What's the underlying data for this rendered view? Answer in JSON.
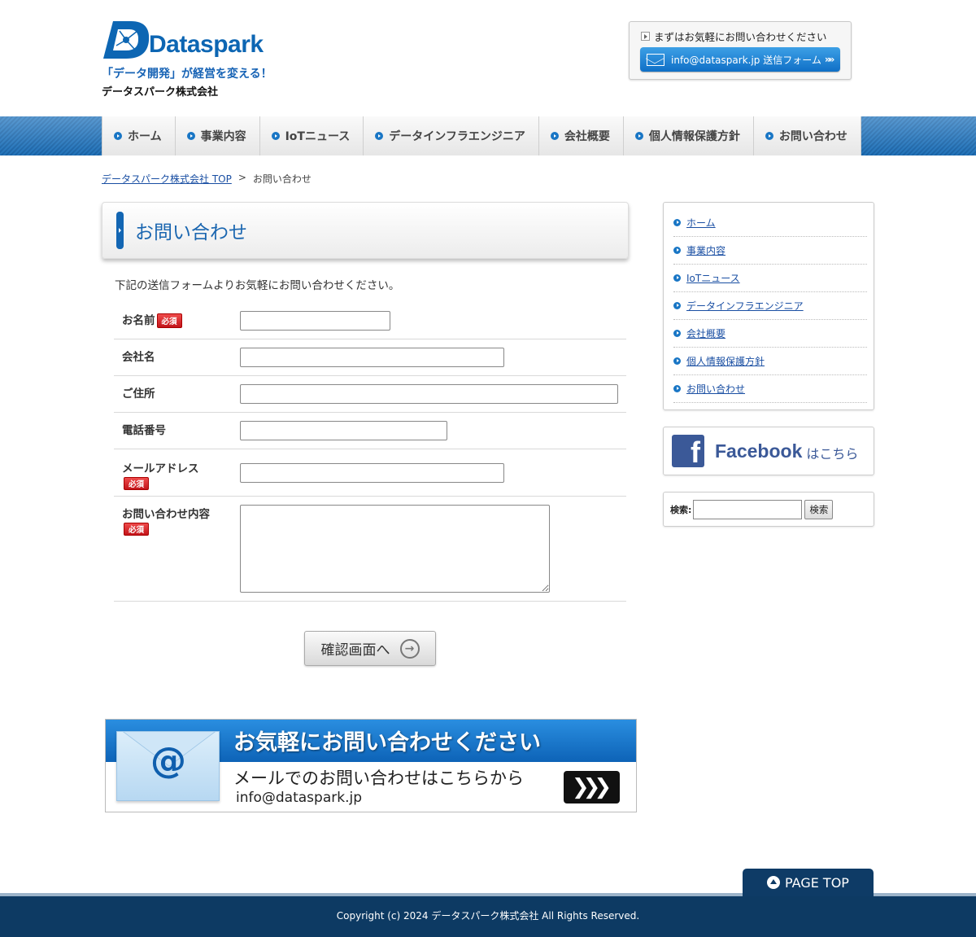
{
  "header": {
    "logo_text": "Dataspark",
    "tagline": "「データ開発」が経営を変える！",
    "company": "データスパーク株式会社",
    "contact_note": "まずはお気軽にお問い合わせください",
    "contact_button": "info@dataspark.jp 送信フォーム"
  },
  "nav": [
    {
      "label": "ホーム"
    },
    {
      "label": "事業内容"
    },
    {
      "label": "IoTニュース"
    },
    {
      "label": "データインフラエンジニア"
    },
    {
      "label": "会社概要"
    },
    {
      "label": "個人情報保護方針"
    },
    {
      "label": "お問い合わせ"
    }
  ],
  "breadcrumb": {
    "home": "データスパーク株式会社 TOP",
    "separator": ">",
    "current": "お問い合わせ"
  },
  "page": {
    "title": "お問い合わせ",
    "intro": "下記の送信フォームよりお気軽にお問い合わせください。"
  },
  "form": {
    "required_badge": "必須",
    "fields": [
      {
        "label": "お名前",
        "value": ""
      },
      {
        "label": "会社名",
        "value": ""
      },
      {
        "label": "ご住所",
        "value": ""
      },
      {
        "label": "電話番号",
        "value": ""
      },
      {
        "label": "メールアドレス",
        "value": ""
      },
      {
        "label": "お問い合わせ内容",
        "value": ""
      }
    ],
    "submit_label": "確認画面へ"
  },
  "banner": {
    "title": "お気軽にお問い合わせください",
    "subtitle": "メールでのお問い合わせはこちらから",
    "email": "info@dataspark.jp",
    "symbol": "@"
  },
  "sidebar": {
    "menu": [
      {
        "label": "ホーム"
      },
      {
        "label": "事業内容"
      },
      {
        "label": "IoTニュース"
      },
      {
        "label": "データインフラエンジニア"
      },
      {
        "label": "会社概要"
      },
      {
        "label": "個人情報保護方針"
      },
      {
        "label": "お問い合わせ"
      }
    ],
    "facebook_word": "Facebook",
    "facebook_suffix": "はこちら",
    "search_label": "検索:",
    "search_button": "検索"
  },
  "footer": {
    "page_top": "PAGE TOP",
    "copyright": "Copyright (c) 2024 データスパーク株式会社 All Rights Reserved."
  },
  "colors": {
    "brand_blue": "#0d66b3",
    "footer_navy": "#0d3a63",
    "required_red": "#c3141a",
    "facebook_blue": "#3b5998"
  }
}
